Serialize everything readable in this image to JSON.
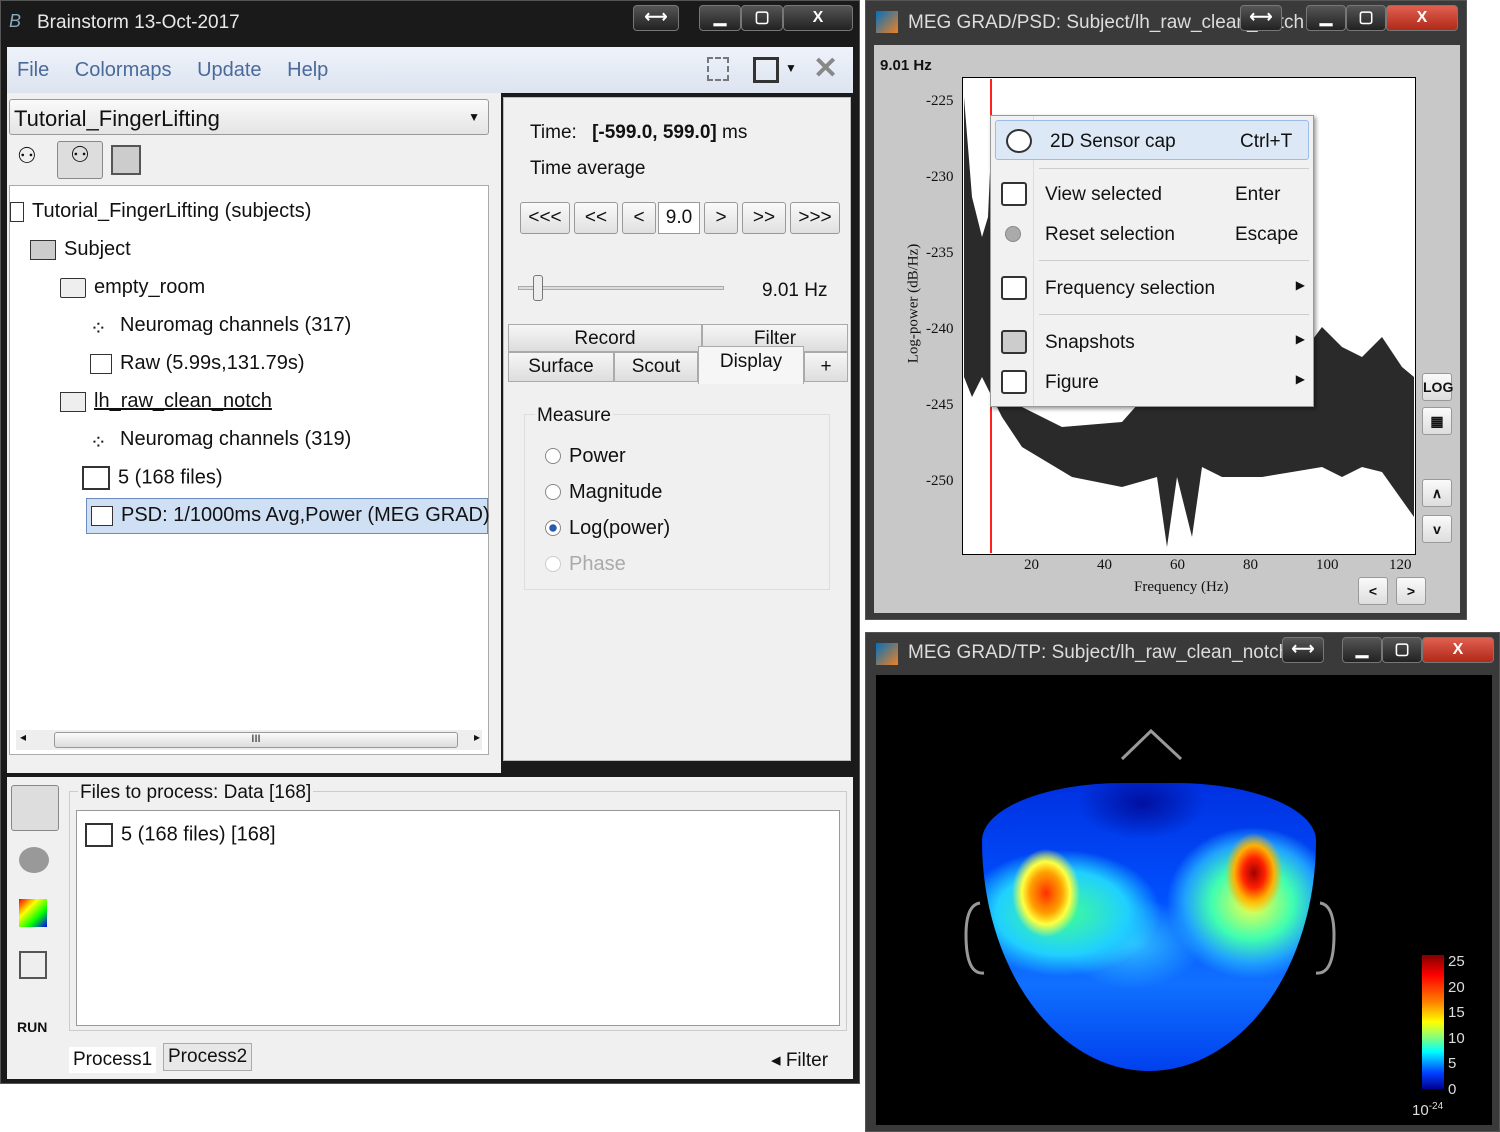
{
  "main_window": {
    "title": "Brainstorm 13-Oct-2017",
    "controls": [
      "⟷",
      "▁",
      "▢",
      "X"
    ],
    "menu": [
      "File",
      "Colormaps",
      "Update",
      "Help"
    ],
    "protocol": "Tutorial_FingerLifting",
    "tree": [
      {
        "label": "Tutorial_FingerLifting (subjects)",
        "icon": "subjects-icon"
      },
      {
        "label": "Subject",
        "icon": "subject-icon"
      },
      {
        "label": "empty_room",
        "icon": "folder-icon"
      },
      {
        "label": "Neuromag channels (317)",
        "icon": "channels-icon"
      },
      {
        "label": "Raw (5.99s,131.79s)",
        "icon": "raw-icon"
      },
      {
        "label": "lh_raw_clean_notch",
        "icon": "folder-icon"
      },
      {
        "label": "Neuromag channels (319)",
        "icon": "channels-icon"
      },
      {
        "label": "5 (168 files)",
        "icon": "data-list-icon"
      },
      {
        "label": "PSD: 1/1000ms Avg,Power (MEG GRAD)",
        "icon": "psd-icon"
      }
    ],
    "scroll_grip": "III",
    "time_label": "Time:",
    "time_value": "[-599.0, 599.0]",
    "time_unit": "ms",
    "time_average": "Time average",
    "nav_buttons": [
      "<<<",
      "<<",
      "<",
      "9.0",
      ">",
      ">>",
      ">>>"
    ],
    "freq_value": "9.01 Hz",
    "freq_slider_fraction": 0.07,
    "tabs_row1": [
      "Record",
      "Filter"
    ],
    "tabs_row2": [
      "Surface",
      "Scout",
      "Display",
      "+"
    ],
    "active_tab": "Display",
    "measure_title": "Measure",
    "measure_options": [
      "Power",
      "Magnitude",
      "Log(power)",
      "Phase"
    ],
    "measure_selected": "Log(power)",
    "files_to_process": "Files to process: Data [168]",
    "process_item": "5 (168 files) [168]",
    "run_label": "RUN",
    "process_tabs": [
      "Process1",
      "Process2"
    ],
    "filter_label": "◂ Filter"
  },
  "psd_window": {
    "title": "MEG GRAD/PSD: Subject/lh_raw_clean_notch",
    "freq_readout": "9.01 Hz",
    "y_ticks": [
      "-225",
      "-230",
      "-235",
      "-240",
      "-245",
      "-250"
    ],
    "x_ticks": [
      "20",
      "40",
      "60",
      "80",
      "100",
      "120"
    ],
    "ylabel": "Log-power   (dB/Hz)",
    "xlabel": "Frequency (Hz)",
    "side_buttons": [
      "LOG",
      "▦",
      "∧",
      "v"
    ],
    "nav_buttons": [
      "<",
      ">"
    ],
    "cursor_color": "#ff2020",
    "context_menu": [
      {
        "label": "2D Sensor cap",
        "shortcut": "Ctrl+T",
        "icon": "sensor-cap-icon",
        "highlighted": true
      },
      {
        "label": "View selected",
        "shortcut": "Enter",
        "icon": "view-selected-icon"
      },
      {
        "label": "Reset selection",
        "shortcut": "Escape",
        "icon": "reset-icon"
      },
      {
        "label": "Frequency selection",
        "submenu": true,
        "icon": "frequency-icon"
      },
      {
        "label": "Snapshots",
        "submenu": true,
        "icon": "camera-icon"
      },
      {
        "label": "Figure",
        "submenu": true,
        "icon": "figure-icon"
      }
    ]
  },
  "topo_window": {
    "title": "MEG GRAD/TP: Subject/lh_raw_clean_notch",
    "colorbar_ticks": [
      "25",
      "20",
      "15",
      "10",
      "5",
      "0"
    ],
    "colorbar_exponent": "10",
    "colorbar_exponent_power": "-24",
    "colormap": "jet"
  }
}
